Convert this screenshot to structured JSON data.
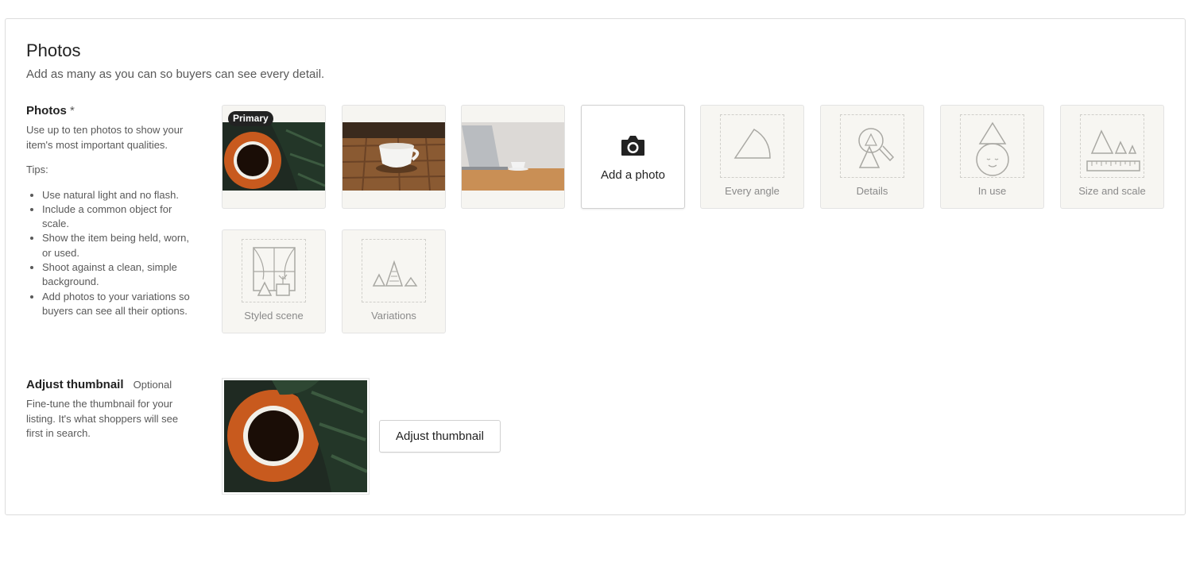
{
  "section": {
    "title": "Photos",
    "subtitle": "Add as many as you can so buyers can see every detail."
  },
  "photos_field": {
    "label": "Photos",
    "required_mark": "*",
    "help": "Use up to ten photos to show your item's most important qualities.",
    "tips_heading": "Tips:",
    "tips": [
      "Use natural light and no flash.",
      "Include a common object for scale.",
      "Show the item being held, worn, or used.",
      "Shoot against a clean, simple background.",
      "Add photos to your variations so buyers can see all their options."
    ]
  },
  "photo_tiles": [
    {
      "badge": "Primary",
      "image": "coffee-cup-on-orange-saucer-top-view"
    },
    {
      "image": "white-coffee-cup-on-wooden-table"
    },
    {
      "image": "laptop-and-cup-on-desk"
    }
  ],
  "add_photo": {
    "label": "Add a photo",
    "icon": "camera-icon"
  },
  "placeholders": [
    {
      "label": "Every angle",
      "icon": "every-angle-icon"
    },
    {
      "label": "Details",
      "icon": "details-magnifier-icon"
    },
    {
      "label": "In use",
      "icon": "in-use-icon"
    },
    {
      "label": "Size and scale",
      "icon": "size-scale-icon"
    },
    {
      "label": "Styled scene",
      "icon": "styled-scene-icon"
    },
    {
      "label": "Variations",
      "icon": "variations-icon"
    }
  ],
  "thumbnail_field": {
    "label": "Adjust thumbnail",
    "optional": "Optional",
    "help": "Fine-tune the thumbnail for your listing. It's what shoppers will see first in search.",
    "button": "Adjust thumbnail"
  },
  "colors": {
    "text": "#222222",
    "muted": "#595959",
    "tile_bg": "#f7f6f2",
    "border": "#dcdcdc"
  }
}
